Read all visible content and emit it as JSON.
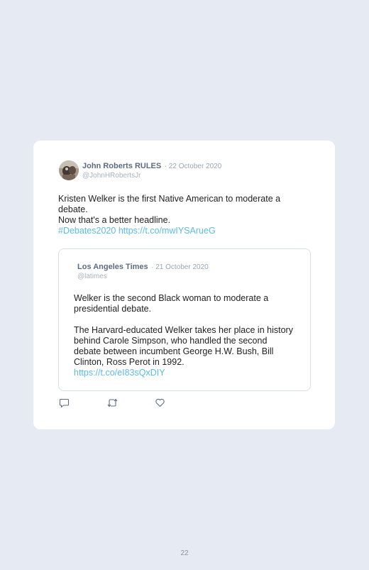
{
  "tweet": {
    "author_name": "John Roberts RULES",
    "date": "· 22 October 2020",
    "handle": "@JohnHRobertsJr",
    "text_lines": [
      "Kristen Welker is the first Native American to moderate a debate.",
      "Now that's a better headline."
    ],
    "hashtag": "#Debates2020",
    "link": "https://t.co/mwIYSArueG"
  },
  "quoted_tweet": {
    "author_name": "Los Angeles Times",
    "date": "· 21 October 2020",
    "handle": "@latimes",
    "paragraph_1": "Welker is the second Black woman to moderate a presidential debate.",
    "paragraph_2": "The Harvard-educated Welker takes her place in history behind Carole Simpson, who handled the second debate between incumbent George H.W. Bush, Bill Clinton, Ross Perot in 1992.",
    "link": "https://t.co/eI83sQxDIY"
  },
  "actions": {
    "reply_icon": "comment-icon",
    "retweet_icon": "retweet-icon",
    "like_icon": "heart-icon"
  },
  "colors": {
    "background": "#e6eaf3",
    "link": "#5bbce4",
    "name": "#5d6b80"
  },
  "page_number": "22"
}
